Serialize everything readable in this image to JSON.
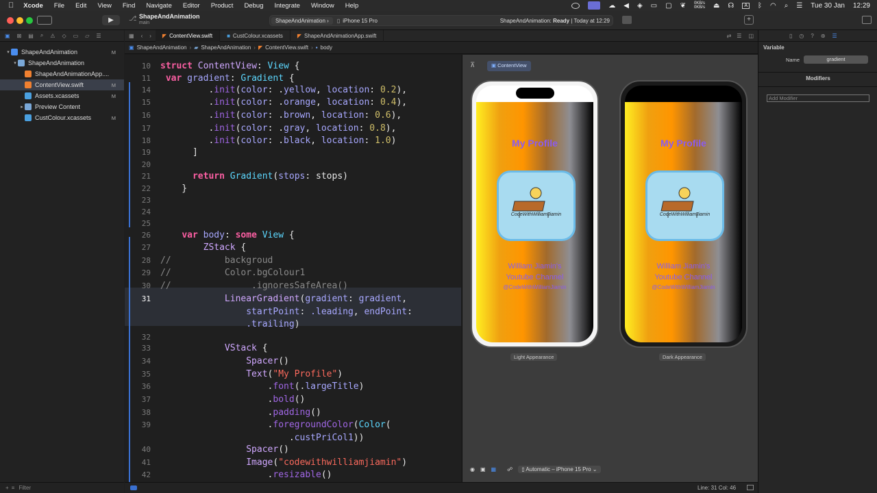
{
  "menubar": {
    "app": "Xcode",
    "items": [
      "File",
      "Edit",
      "View",
      "Find",
      "Navigate",
      "Editor",
      "Product",
      "Debug",
      "Integrate",
      "Window",
      "Help"
    ],
    "net_speed": "0KB/s",
    "date": "Tue 30 Jan",
    "time": "12:29"
  },
  "toolbar": {
    "project": "ShapeAndAnimation",
    "branch": "main",
    "scheme": "ShapeAndAnimation",
    "device": "iPhone 15 Pro",
    "status_project": "ShapeAndAnimation:",
    "status_state": "Ready",
    "status_time": "| Today at 12:29"
  },
  "navigator": {
    "items": [
      {
        "label": "ShapeAndAnimation",
        "badge": "M",
        "depth": 0,
        "icon": "project-icon"
      },
      {
        "label": "ShapeAndAnimation",
        "badge": "",
        "depth": 1,
        "icon": "folder-icon"
      },
      {
        "label": "ShapeAndAnimationApp....",
        "badge": "",
        "depth": 2,
        "icon": "swift-file-icon"
      },
      {
        "label": "ContentView.swift",
        "badge": "M",
        "depth": 2,
        "icon": "swift-file-icon"
      },
      {
        "label": "Assets.xcassets",
        "badge": "M",
        "depth": 2,
        "icon": "asset-catalog-icon"
      },
      {
        "label": "Preview Content",
        "badge": "",
        "depth": 2,
        "icon": "folder-icon"
      },
      {
        "label": "CustColour.xcassets",
        "badge": "M",
        "depth": 2,
        "icon": "asset-catalog-icon"
      }
    ],
    "filter_placeholder": "Filter"
  },
  "tabs": [
    "ContentView.swift",
    "CustColour.xcassets",
    "ShapeAndAnimationApp.swift"
  ],
  "jumpbar": [
    "ShapeAndAnimation",
    "ShapeAndAnimation",
    "ContentView.swift",
    "body"
  ],
  "editor": {
    "current_line": "31",
    "lines": [
      {
        "n": "10",
        "code": [
          [
            "kw",
            "struct "
          ],
          [
            "ty",
            "ContentView"
          ],
          [
            "",
            "："
          ],
          [
            "tyn",
            "View"
          ],
          [
            "",
            ""
          ]
        ]
      },
      {
        "n": "11",
        "code": []
      },
      {
        "n": "14",
        "code": []
      },
      {
        "n": "15",
        "code": []
      },
      {
        "n": "16",
        "code": []
      },
      {
        "n": "17",
        "code": []
      },
      {
        "n": "18",
        "code": []
      },
      {
        "n": "19",
        "code": []
      },
      {
        "n": "20",
        "code": []
      },
      {
        "n": "21",
        "code": []
      },
      {
        "n": "22",
        "code": []
      },
      {
        "n": "23",
        "code": []
      },
      {
        "n": "24",
        "code": []
      },
      {
        "n": "25",
        "code": []
      },
      {
        "n": "26",
        "code": []
      },
      {
        "n": "27",
        "code": []
      },
      {
        "n": "28",
        "code": []
      },
      {
        "n": "29",
        "code": []
      },
      {
        "n": "30",
        "code": []
      },
      {
        "n": "31",
        "code": []
      },
      {
        "n": "32",
        "code": []
      },
      {
        "n": "33",
        "code": []
      },
      {
        "n": "34",
        "code": []
      },
      {
        "n": "35",
        "code": []
      },
      {
        "n": "36",
        "code": []
      },
      {
        "n": "37",
        "code": []
      },
      {
        "n": "38",
        "code": []
      },
      {
        "n": "39",
        "code": []
      },
      {
        "n": "40",
        "code": []
      },
      {
        "n": "41",
        "code": []
      },
      {
        "n": "42",
        "code": []
      }
    ]
  },
  "canvas": {
    "pin_label": "ContentView",
    "preview_title": "My Profile",
    "preview_name": "William Jiamin's",
    "preview_channel": "Youtube Channel",
    "preview_handle": "@CodeWithWilliamJiamin",
    "logo_text": "CodeWithWilliamJiamin",
    "light_label": "Light Appearance",
    "dark_label": "Dark Appearance",
    "device_menu": "Automatic – iPhone 15 Pro"
  },
  "inspector": {
    "section": "Variable",
    "name_label": "Name",
    "name_value": "gradient",
    "modifiers_title": "Modifiers",
    "add_modifier_placeholder": "Add Modifier"
  },
  "statusbar": {
    "position": "Line: 31  Col: 46"
  },
  "colors": {
    "accent": "#3a70d0",
    "keyword": "#fc5fa3",
    "type": "#d0a8ff",
    "string": "#fc6a5d",
    "number": "#d0bf69",
    "profile_text": "#8a5cf0"
  }
}
